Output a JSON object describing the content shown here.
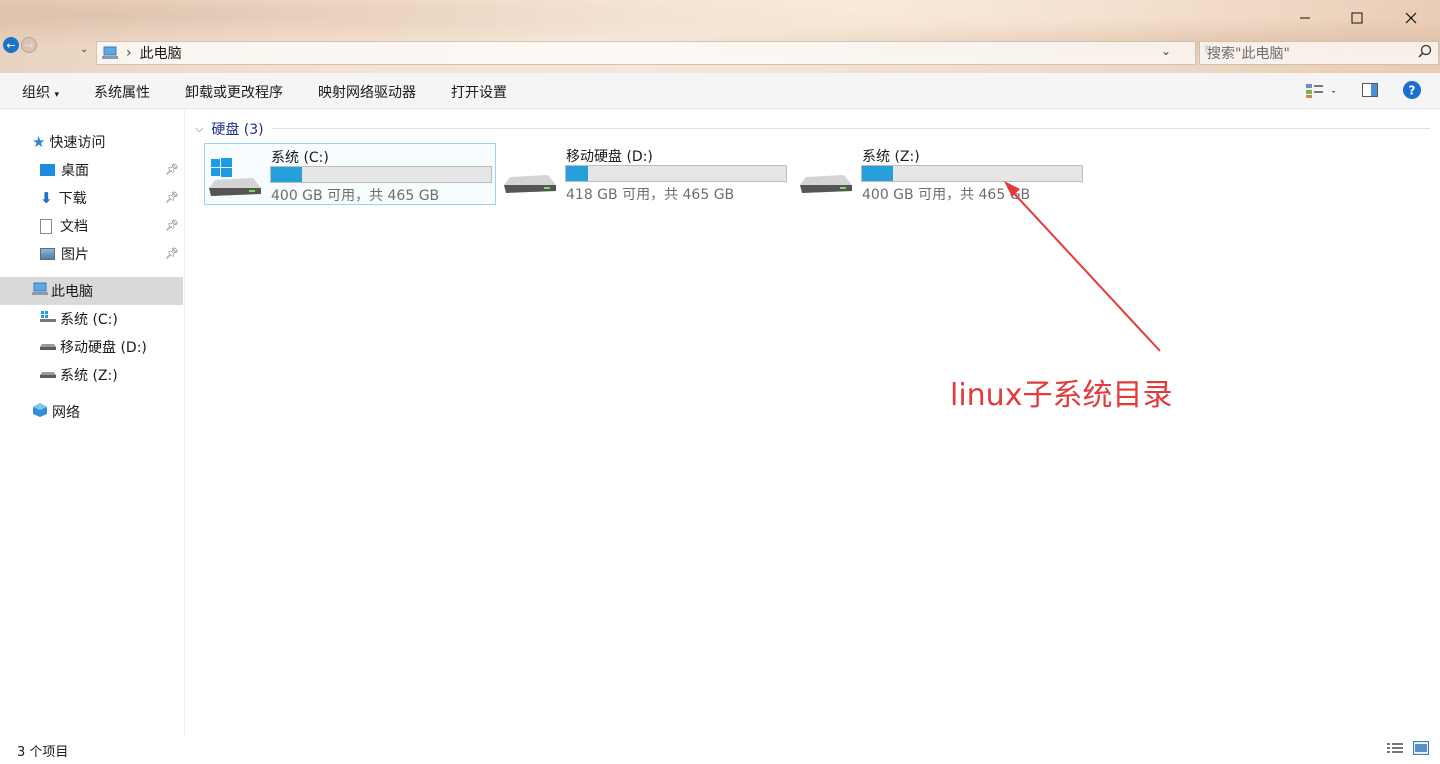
{
  "window": {
    "controls": [
      "minimize",
      "maximize",
      "close"
    ]
  },
  "address": {
    "path_icon": "computer-icon",
    "separator": "›",
    "current": "此电脑",
    "search_placeholder": "搜索\"此电脑\""
  },
  "ribbon": {
    "organize": "组织",
    "system_props": "系统属性",
    "uninstall": "卸载或更改程序",
    "map_drive": "映射网络驱动器",
    "open_settings": "打开设置"
  },
  "sidebar": {
    "quick_access": "快速访问",
    "quick_items": [
      {
        "label": "桌面",
        "icon": "desktop-icon"
      },
      {
        "label": "下载",
        "icon": "download-icon"
      },
      {
        "label": "文档",
        "icon": "document-icon"
      },
      {
        "label": "图片",
        "icon": "pictures-icon"
      }
    ],
    "this_pc": "此电脑",
    "drives": [
      {
        "label": "系统 (C:)"
      },
      {
        "label": "移动硬盘 (D:)"
      },
      {
        "label": "系统 (Z:)"
      }
    ],
    "network": "网络"
  },
  "content": {
    "group_label": "硬盘 (3)",
    "drives": [
      {
        "name": "系统 (C:)",
        "info": "400 GB 可用，共 465 GB",
        "used_fraction": 0.14,
        "windows": true
      },
      {
        "name": "移动硬盘 (D:)",
        "info": "418 GB 可用，共 465 GB",
        "used_fraction": 0.1,
        "windows": false
      },
      {
        "name": "系统 (Z:)",
        "info": "400 GB 可用，共 465 GB",
        "used_fraction": 0.14,
        "windows": false
      }
    ]
  },
  "annotation": {
    "text": "linux子系统目录",
    "color": "#e33b3b"
  },
  "status": {
    "count": "3 个项目"
  },
  "colors": {
    "accent": "#26a0da",
    "group_header": "#1e3287",
    "selection": "#d9d9d9"
  }
}
